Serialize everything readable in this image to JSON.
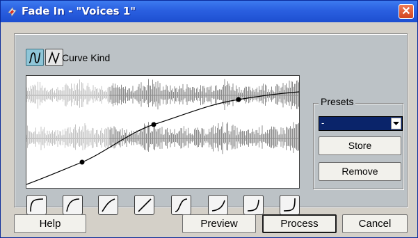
{
  "window": {
    "title": "Fade In - \"Voices 1\"",
    "close_glyph": "✕",
    "app_icon": "cubase-icon"
  },
  "curve_kind": {
    "label": "Curve Kind",
    "options": [
      "spline-interpolation",
      "linear-interpolation"
    ],
    "selected_index": 0
  },
  "presets": {
    "label": "Presets",
    "selected_value": "-",
    "store_label": "Store",
    "remove_label": "Remove"
  },
  "curve_presets": [
    "curve-preset-1-icon",
    "curve-preset-2-icon",
    "curve-preset-3-icon",
    "curve-preset-4-icon",
    "curve-preset-5-icon",
    "curve-preset-6-icon",
    "curve-preset-7-icon",
    "curve-preset-8-icon"
  ],
  "buttons": {
    "help": "Help",
    "preview": "Preview",
    "process": "Process",
    "cancel": "Cancel"
  },
  "colors": {
    "title_bar": "#2a5fe0",
    "kind_selected": "#8fc6d8",
    "selection": "#0a246a",
    "close_button": "#d2461f"
  }
}
